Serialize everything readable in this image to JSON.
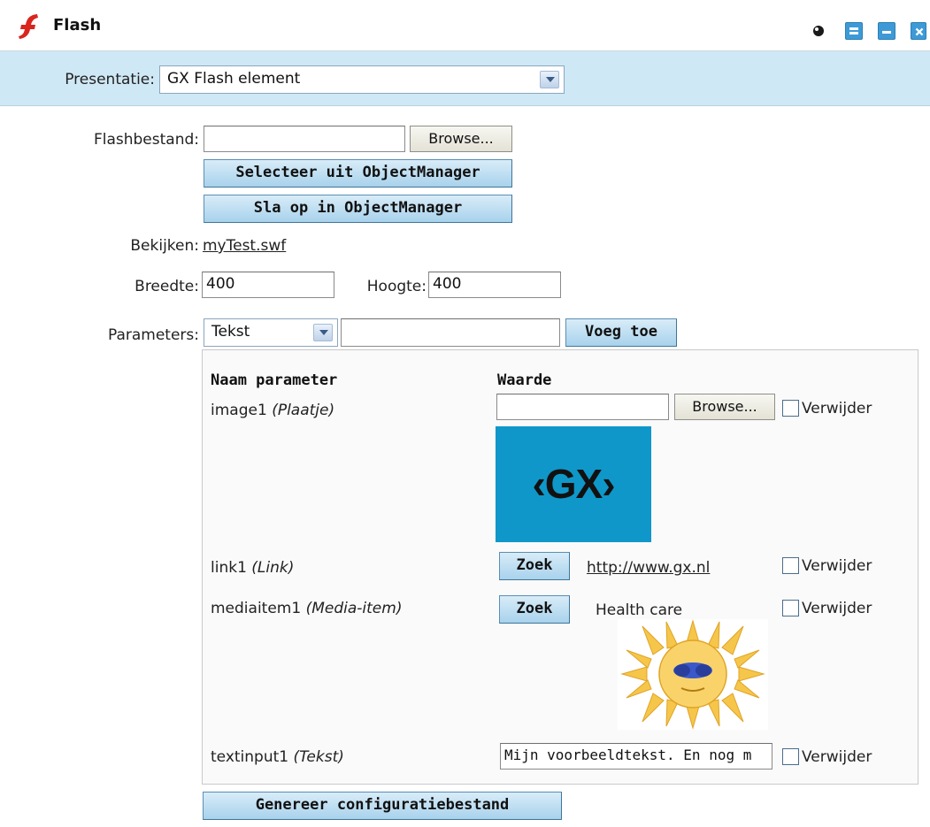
{
  "window": {
    "title": "Flash",
    "icons": [
      "flash-logo-icon",
      "circle-icon",
      "maximize-icon",
      "minimize-icon",
      "close-icon"
    ],
    "accent": "#3d9ad6"
  },
  "presentation": {
    "label": "Presentatie:",
    "selected": "GX Flash element"
  },
  "file": {
    "label": "Flashbestand:",
    "value": "",
    "browse_label": "Browse...",
    "select_om_label": "Selecteer uit ObjectManager",
    "save_om_label": "Sla op in ObjectManager"
  },
  "preview": {
    "label": "Bekijken:",
    "link": "myTest.swf"
  },
  "size": {
    "width_label": "Breedte:",
    "width_value": "400",
    "height_label": "Hoogte:",
    "height_value": "400"
  },
  "parameters": {
    "label": "Parameters:",
    "type_selected": "Tekst",
    "name_value": "",
    "add_label": "Voeg toe",
    "col_name": "Naam parameter",
    "col_value": "Waarde",
    "rows": [
      {
        "name": "image1",
        "type": "(Plaatje)",
        "browse_label": "Browse...",
        "remove_label": "Verwijder",
        "image_text": "‹GX›",
        "image_bg": "#0f97c9"
      },
      {
        "name": "link1",
        "type": "(Link)",
        "search_label": "Zoek",
        "link": "http://www.gx.nl",
        "remove_label": "Verwijder"
      },
      {
        "name": "mediaitem1",
        "type": "(Media-item)",
        "search_label": "Zoek",
        "media_title": "Health care",
        "remove_label": "Verwijder"
      },
      {
        "name": "textinput1",
        "type": "(Tekst)",
        "value": "Mijn voorbeeldtekst. En nog m",
        "remove_label": "Verwijder"
      }
    ]
  },
  "generate_label": "Genereer configuratiebestand"
}
